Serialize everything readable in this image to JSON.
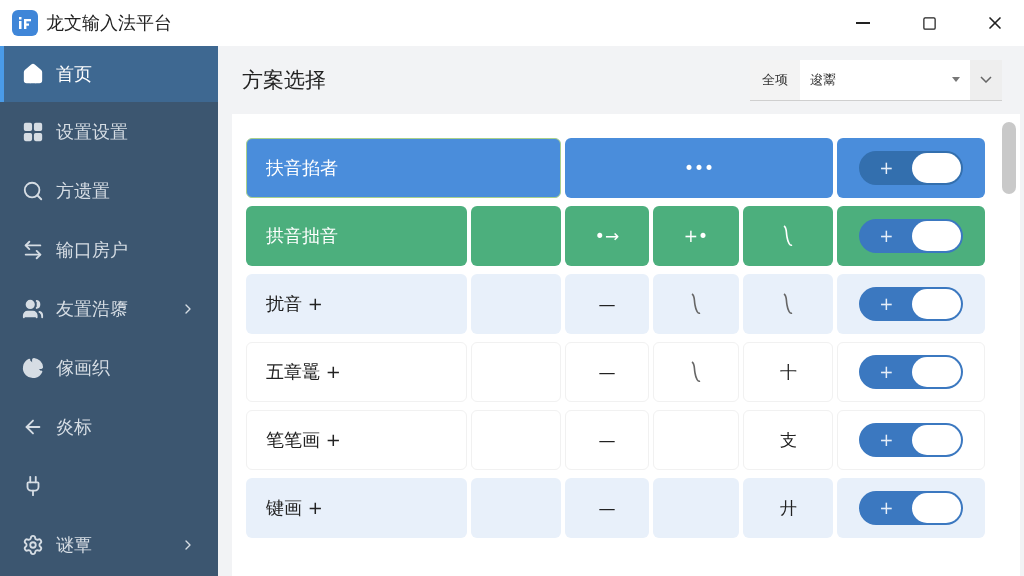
{
  "window": {
    "title": "龙文输入法平台"
  },
  "sidebar": {
    "items": [
      {
        "label": "首页",
        "selected": true,
        "has_submenu": false
      },
      {
        "label": "设置设置",
        "selected": false,
        "has_submenu": false
      },
      {
        "label": "方遗置",
        "selected": false,
        "has_submenu": false
      },
      {
        "label": "输口房户",
        "selected": false,
        "has_submenu": false
      },
      {
        "label": "友置浩隳",
        "selected": false,
        "has_submenu": true
      },
      {
        "label": "傢画织",
        "selected": false,
        "has_submenu": false
      },
      {
        "label": "炎标",
        "selected": false,
        "has_submenu": false
      },
      {
        "selected": false,
        "has_submenu": false
      },
      {
        "label": "谜覃",
        "selected": false,
        "has_submenu": true
      }
    ]
  },
  "header": {
    "title": "方案选择",
    "filter_tab": "全项",
    "select_value": "逡鬻"
  },
  "rows": [
    {
      "name": "扶音掐者",
      "kind": "blue",
      "merged": true,
      "cells": [
        {
          "kind": "text",
          "text": "•••"
        }
      ],
      "toggle": {
        "label": "+",
        "on": true
      }
    },
    {
      "name": "拱音拙音",
      "kind": "green",
      "merged": false,
      "cells": [
        {
          "kind": "text",
          "text": "•→"
        },
        {
          "kind": "text",
          "text": "+•"
        },
        {
          "kind": "squiggle"
        }
      ],
      "toggle": {
        "label": "+",
        "on": true
      }
    },
    {
      "name": "扰音 +",
      "kind": "light",
      "merged": false,
      "cells": [
        {
          "kind": "text",
          "text": "—"
        },
        {
          "kind": "squiggle"
        },
        {
          "kind": "squiggle"
        }
      ],
      "toggle": {
        "label": "+",
        "on": true
      }
    },
    {
      "name": "五章鼍 +",
      "kind": "white",
      "merged": false,
      "cells": [
        {
          "kind": "text",
          "text": "—"
        },
        {
          "kind": "squiggle"
        },
        {
          "kind": "text",
          "text": "十"
        }
      ],
      "toggle": {
        "label": "+",
        "on": true
      }
    },
    {
      "name": "笔笔画 +",
      "kind": "white",
      "merged": false,
      "cells": [
        {
          "kind": "text",
          "text": "—"
        },
        {
          "kind": "empty"
        },
        {
          "kind": "text",
          "text": "支"
        }
      ],
      "toggle": {
        "label": "+",
        "on": true
      }
    },
    {
      "name": "键画 +",
      "kind": "light",
      "merged": false,
      "cells": [
        {
          "kind": "text",
          "text": "—"
        },
        {
          "kind": "empty"
        },
        {
          "kind": "text",
          "text": "廾"
        }
      ],
      "toggle": {
        "label": "+",
        "on": true
      }
    }
  ]
}
